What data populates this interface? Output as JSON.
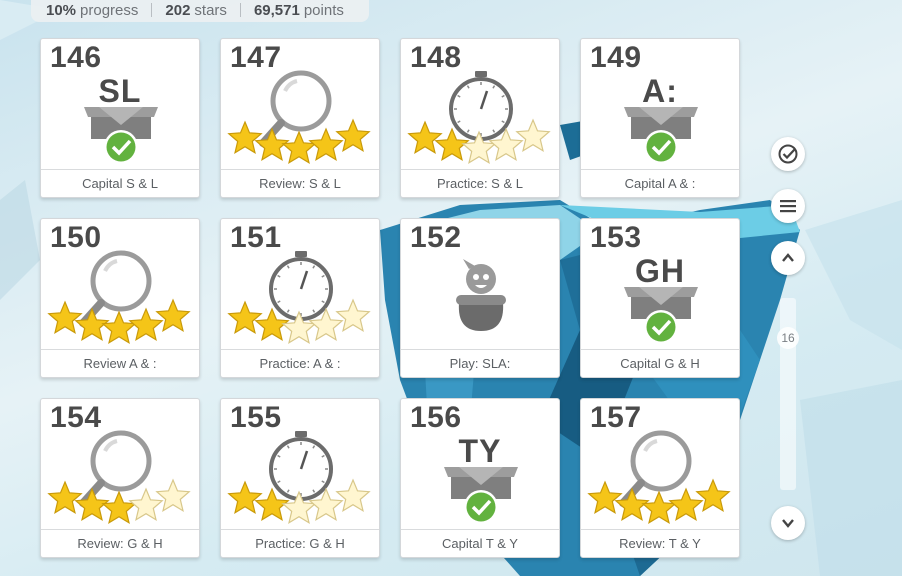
{
  "stats": {
    "progress_value": "10%",
    "progress_label": "progress",
    "stars_value": "202",
    "stars_label": "stars",
    "points_value": "69,571",
    "points_label": "points"
  },
  "lessons": [
    {
      "number": "146",
      "type": "capital",
      "letters": "SL",
      "completed": true,
      "label": "Capital S & L"
    },
    {
      "number": "147",
      "type": "review",
      "stars": 5,
      "label": "Review: S & L"
    },
    {
      "number": "148",
      "type": "practice",
      "stars": 2,
      "label": "Practice: S & L"
    },
    {
      "number": "149",
      "type": "capital",
      "letters": "A:",
      "completed": true,
      "label": "Capital A & :"
    },
    {
      "number": "150",
      "type": "review",
      "stars": 5,
      "label": "Review A & :"
    },
    {
      "number": "151",
      "type": "practice",
      "stars": 2,
      "label": "Practice: A & :"
    },
    {
      "number": "152",
      "type": "play",
      "label": "Play: SLA:"
    },
    {
      "number": "153",
      "type": "capital",
      "letters": "GH",
      "completed": true,
      "label": "Capital G & H"
    },
    {
      "number": "154",
      "type": "review",
      "stars": 3,
      "label": "Review: G & H"
    },
    {
      "number": "155",
      "type": "practice",
      "stars": 2,
      "label": "Practice: G & H"
    },
    {
      "number": "156",
      "type": "capital",
      "letters": "TY",
      "completed": true,
      "label": "Capital T & Y"
    },
    {
      "number": "157",
      "type": "review",
      "stars": 5,
      "label": "Review: T & Y"
    }
  ],
  "scroll": {
    "page_indicator": "16"
  },
  "colors": {
    "star_fill": "#f5c518",
    "star_empty": "#fff6d0",
    "check_green": "#62b23f",
    "box_gray": "#8c8c8c"
  }
}
